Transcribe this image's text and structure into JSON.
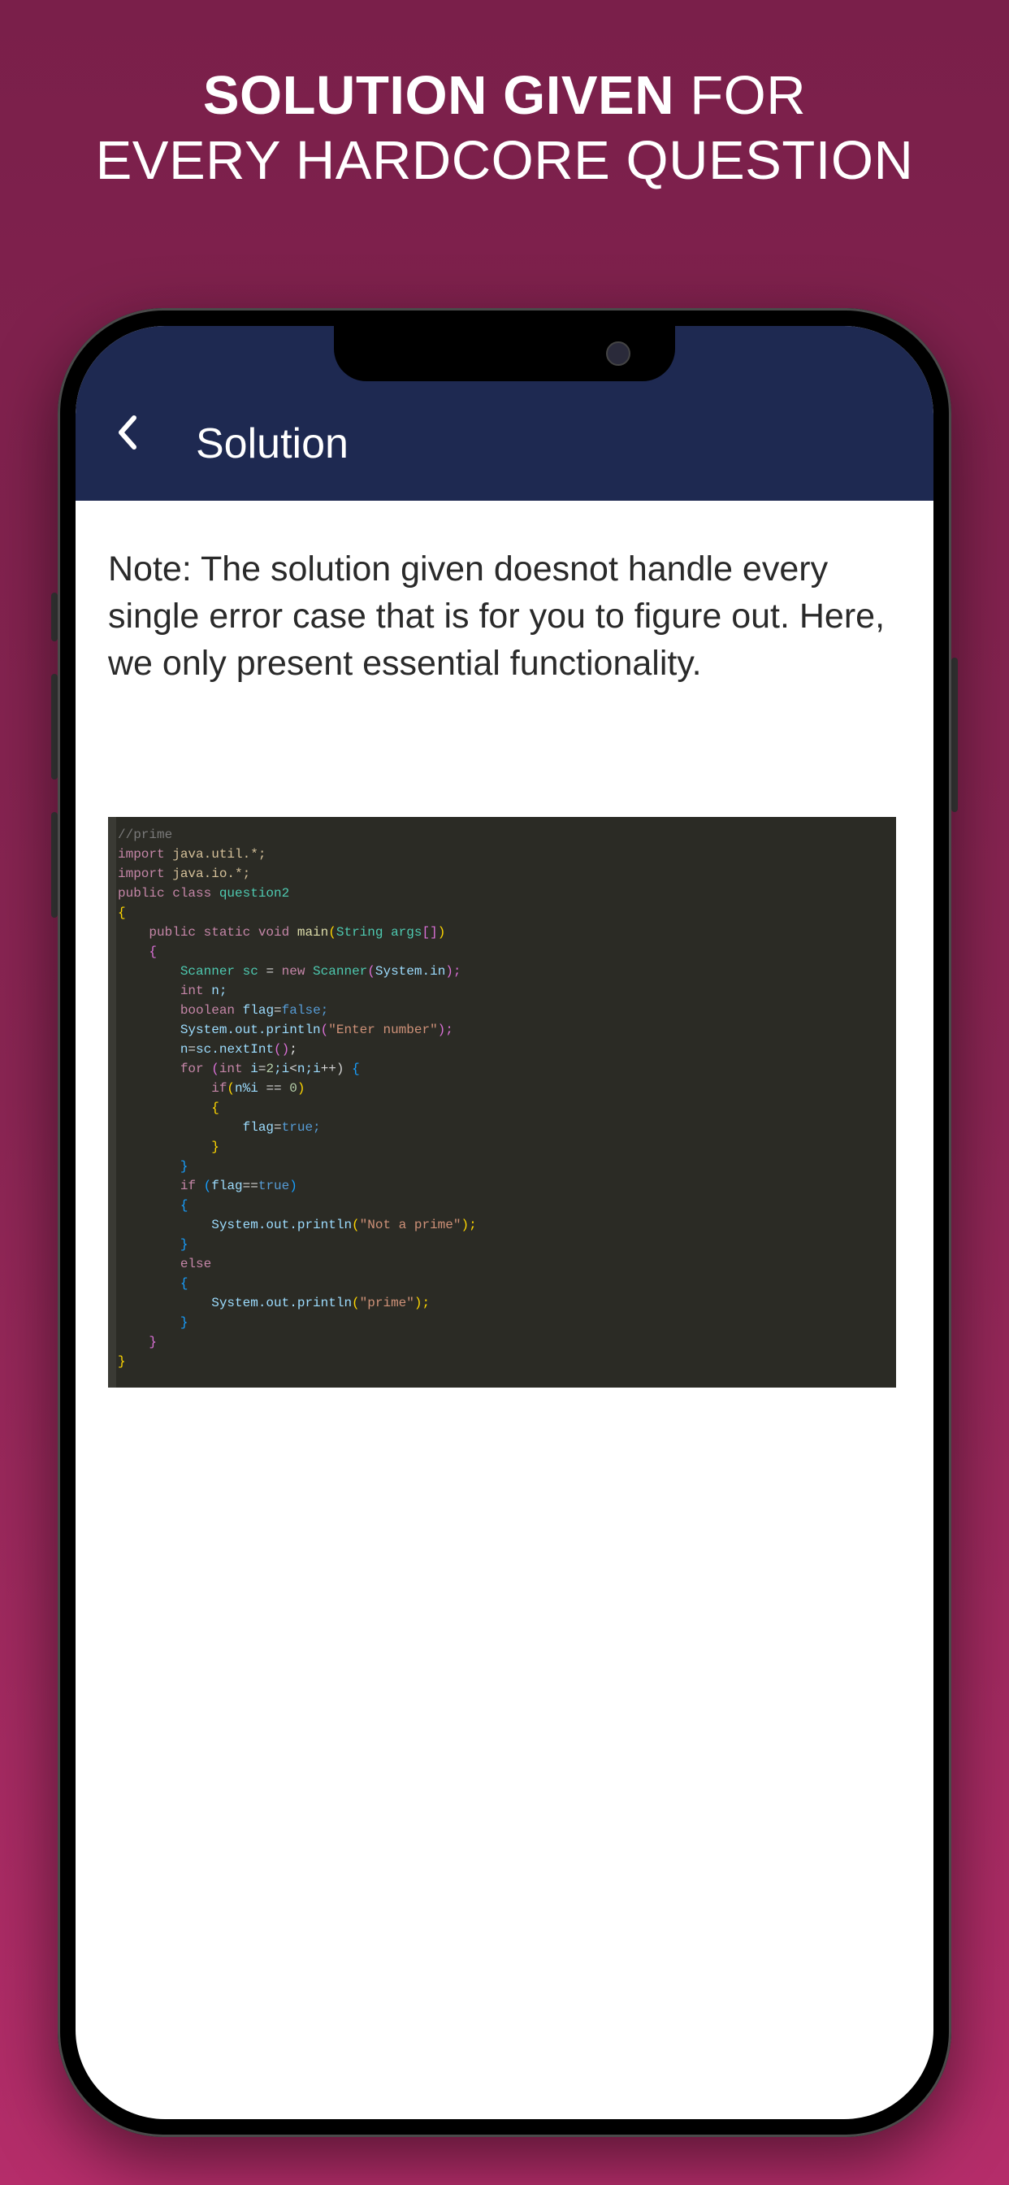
{
  "headline": {
    "bold": "SOLUTION GIVEN",
    "regular_after_bold": " FOR",
    "line2": "EVERY HARDCORE QUESTION"
  },
  "app": {
    "header_title": "Solution",
    "note_text": "Note: The solution given doesnot handle every single error case that is for you to figure out. Here, we only present essential functionality."
  },
  "code": {
    "l1_comment": "//prime",
    "l2_import": "import",
    "l2_pkg": " java.util.*;",
    "l3_import": "import",
    "l3_pkg": " java.io.*;",
    "l4_public": "public class",
    "l4_class": " question2",
    "l5_brace": "{",
    "l6_indent": "    ",
    "l6_mod": "public static void",
    "l6_main": " main",
    "l6_paren_o": "(",
    "l6_str": "String args",
    "l6_brk": "[]",
    "l6_paren_c": ")",
    "l7_indent": "    ",
    "l7_brace": "{",
    "l8_indent": "        ",
    "l8_scanner": "Scanner sc ",
    "l8_eq": "= ",
    "l8_new": "new",
    "l8_sc2": " Scanner",
    "l8_po": "(",
    "l8_sysin": "System.in",
    "l8_pc": ");",
    "l9_indent": "        ",
    "l9_int": "int",
    "l9_n": " n;",
    "l10_indent": "        ",
    "l10_bool": "boolean",
    "l10_flag": " flag",
    "l10_eq": "=",
    "l10_false": "false;",
    "l11_indent": "        ",
    "l11_sys": "System.out.println",
    "l11_po": "(",
    "l11_str": "\"Enter number\"",
    "l11_pc": ");",
    "l12_indent": "        ",
    "l12_n": "n",
    "l12_eq": "=",
    "l12_sc": "sc.nextInt",
    "l12_po": "()",
    "l12_sc2": ";",
    "l13_indent": "        ",
    "l13_for": "for ",
    "l13_po": "(",
    "l13_int": "int",
    "l13_i": " i",
    "l13_eq": "=",
    "l13_2": "2",
    "l13_semi": ";i",
    "l13_lt": "<",
    "l13_n": "n;i",
    "l13_pp": "++) ",
    "l13_bo": "{",
    "l14_indent": "            ",
    "l14_if": "if",
    "l14_po": "(",
    "l14_ni": "n%i ",
    "l14_eq": "== ",
    "l14_0": "0",
    "l14_pc": ")",
    "l15_indent": "            ",
    "l15_bo": "{",
    "l16_indent": "                ",
    "l16_flag": "flag",
    "l16_eq": "=",
    "l16_true": "true;",
    "l17_indent": "            ",
    "l17_bc": "}",
    "l18_indent": "        ",
    "l18_bc": "}",
    "l19_indent": "        ",
    "l19_if": "if ",
    "l19_po": "(",
    "l19_flag": "flag",
    "l19_eq": "==",
    "l19_true": "true",
    "l19_pc": ")",
    "l20_indent": "        ",
    "l20_bo": "{",
    "l21_indent": "            ",
    "l21_sys": "System.out.println",
    "l21_po": "(",
    "l21_str": "\"Not a prime\"",
    "l21_pc": ");",
    "l22_indent": "        ",
    "l22_bc": "}",
    "l23_indent": "        ",
    "l23_else": "else",
    "l24_indent": "        ",
    "l24_bo": "{",
    "l25_indent": "            ",
    "l25_sys": "System.out.println",
    "l25_po": "(",
    "l25_str": "\"prime\"",
    "l25_pc": ");",
    "l26_indent": "        ",
    "l26_bc": "}",
    "l27_indent": "    ",
    "l27_bc": "}",
    "l28_bc": "}"
  }
}
